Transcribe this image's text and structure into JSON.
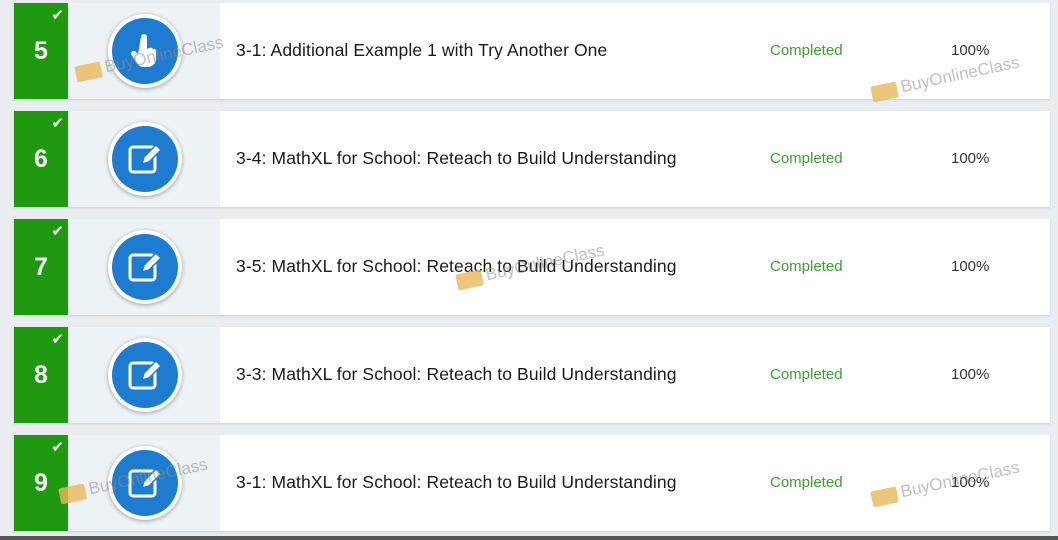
{
  "items": [
    {
      "number": "5",
      "icon": "pointer-hand-icon",
      "title": "3-1: Additional Example 1 with Try Another One",
      "status": "Completed",
      "percent": "100%"
    },
    {
      "number": "6",
      "icon": "edit-icon",
      "title": "3-4: MathXL for School: Reteach to Build Understanding",
      "status": "Completed",
      "percent": "100%"
    },
    {
      "number": "7",
      "icon": "edit-icon",
      "title": "3-5: MathXL for School: Reteach to Build Understanding",
      "status": "Completed",
      "percent": "100%"
    },
    {
      "number": "8",
      "icon": "edit-icon",
      "title": "3-3: MathXL for School: Reteach to Build Understanding",
      "status": "Completed",
      "percent": "100%"
    },
    {
      "number": "9",
      "icon": "edit-icon",
      "title": "3-1: MathXL for School: Reteach to Build Understanding",
      "status": "Completed",
      "percent": "100%"
    }
  ],
  "check_icon": "checkmark-icon",
  "watermark": "BuyOnlineClass",
  "colors": {
    "number_bg": "#1f9a10",
    "icon_bg": "#1d7bd0",
    "status": "#3aa12f"
  }
}
